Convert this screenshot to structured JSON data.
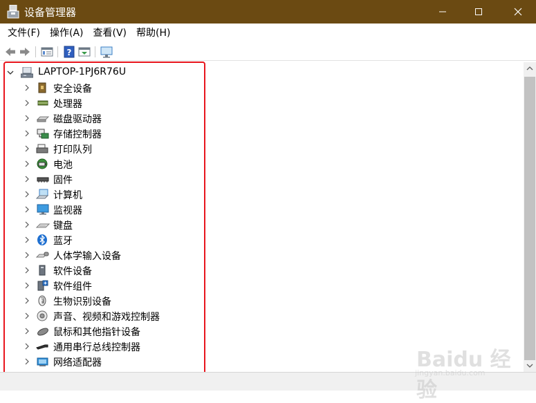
{
  "window": {
    "title": "设备管理器",
    "icon": "device-manager-icon"
  },
  "menu": [
    "文件(F)",
    "操作(A)",
    "查看(V)",
    "帮助(H)"
  ],
  "toolbar": {
    "buttons": [
      "back-arrow-icon",
      "forward-arrow-icon",
      "properties-icon",
      "help-icon",
      "update-driver-icon",
      "scan-hardware-icon"
    ]
  },
  "tree": {
    "root": {
      "label": "LAPTOP-1PJ6R76U",
      "icon": "computer-icon",
      "expanded": true
    },
    "items": [
      {
        "label": "安全设备",
        "icon": "security-device-icon"
      },
      {
        "label": "处理器",
        "icon": "processor-icon"
      },
      {
        "label": "磁盘驱动器",
        "icon": "disk-drive-icon"
      },
      {
        "label": "存储控制器",
        "icon": "storage-controller-icon"
      },
      {
        "label": "打印队列",
        "icon": "print-queue-icon"
      },
      {
        "label": "电池",
        "icon": "battery-icon"
      },
      {
        "label": "固件",
        "icon": "firmware-icon"
      },
      {
        "label": "计算机",
        "icon": "computer-icon"
      },
      {
        "label": "监视器",
        "icon": "monitor-icon"
      },
      {
        "label": "键盘",
        "icon": "keyboard-icon"
      },
      {
        "label": "蓝牙",
        "icon": "bluetooth-icon"
      },
      {
        "label": "人体学输入设备",
        "icon": "hid-icon"
      },
      {
        "label": "软件设备",
        "icon": "software-device-icon"
      },
      {
        "label": "软件组件",
        "icon": "software-component-icon"
      },
      {
        "label": "生物识别设备",
        "icon": "biometric-icon"
      },
      {
        "label": "声音、视频和游戏控制器",
        "icon": "sound-icon"
      },
      {
        "label": "鼠标和其他指针设备",
        "icon": "mouse-icon"
      },
      {
        "label": "通用串行总线控制器",
        "icon": "usb-icon"
      },
      {
        "label": "网络适配器",
        "icon": "network-adapter-icon"
      }
    ]
  },
  "watermark": {
    "text": "Baidu 经验",
    "sub": "jingyan.baidu.com"
  },
  "colors": {
    "titlebar": "#6b4a12",
    "highlight": "#e8141c"
  }
}
